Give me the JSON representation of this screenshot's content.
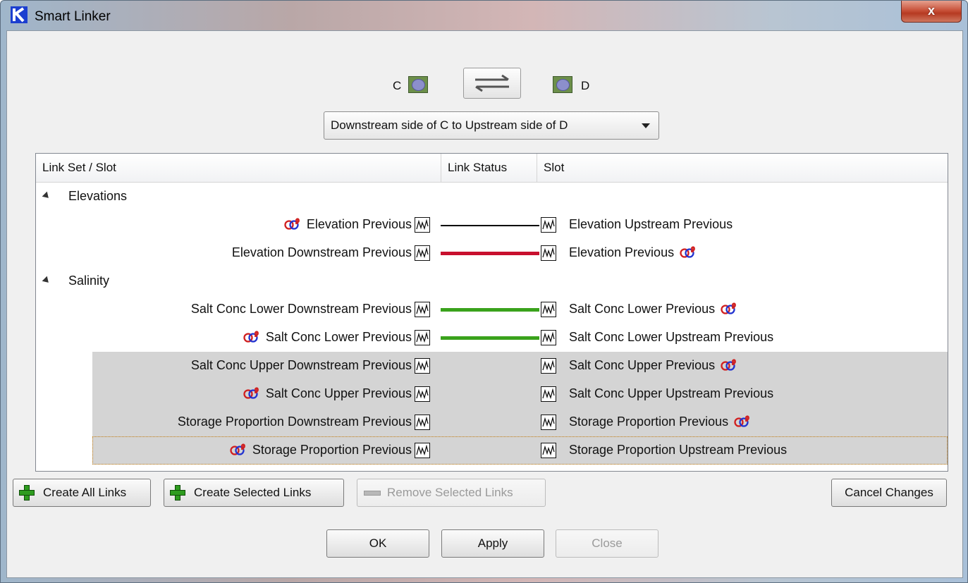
{
  "window": {
    "title": "Smart Linker",
    "close_glyph": "x"
  },
  "header": {
    "left_object": "C",
    "right_object": "D",
    "dropdown_value": "Downstream side of C to Upstream side of D"
  },
  "tree": {
    "columns": [
      "Link Set / Slot",
      "Link Status",
      "Slot"
    ],
    "groups": [
      {
        "label": "Elevations"
      },
      {
        "label": "Salinity"
      }
    ],
    "rows": [
      {
        "left": "Elevation Previous",
        "left_agg": true,
        "right": "Elevation Upstream Previous",
        "right_agg": false,
        "status": "existing",
        "color": "#000000"
      },
      {
        "left": "Elevation Downstream Previous",
        "left_agg": false,
        "right": "Elevation Previous",
        "right_agg": true,
        "status": "removed",
        "color": "#c8102e"
      },
      {
        "left": "Salt Conc Lower Downstream Previous",
        "left_agg": false,
        "right": "Salt Conc Lower Previous",
        "right_agg": true,
        "status": "new",
        "color": "#3aa21c"
      },
      {
        "left": "Salt Conc Lower Previous",
        "left_agg": true,
        "right": "Salt Conc Lower Upstream Previous",
        "right_agg": false,
        "status": "new",
        "color": "#3aa21c"
      },
      {
        "left": "Salt Conc Upper Downstream Previous",
        "left_agg": false,
        "right": "Salt Conc Upper Previous",
        "right_agg": true,
        "status": "none"
      },
      {
        "left": "Salt Conc Upper Previous",
        "left_agg": true,
        "right": "Salt Conc Upper Upstream Previous",
        "right_agg": false,
        "status": "none"
      },
      {
        "left": "Storage Proportion Downstream Previous",
        "left_agg": false,
        "right": "Storage Proportion Previous",
        "right_agg": true,
        "status": "none"
      },
      {
        "left": "Storage Proportion Previous",
        "left_agg": true,
        "right": "Storage Proportion Upstream Previous",
        "right_agg": false,
        "status": "none"
      }
    ]
  },
  "buttons": {
    "create_all": "Create All Links",
    "create_selected": "Create Selected Links",
    "remove_selected": "Remove Selected Links",
    "cancel_changes": "Cancel Changes",
    "ok": "OK",
    "apply": "Apply",
    "close": "Close"
  },
  "colors": {
    "accent_link_new": "#3aa21c",
    "accent_link_removed": "#c8102e",
    "selection": "#d4d4d4"
  }
}
